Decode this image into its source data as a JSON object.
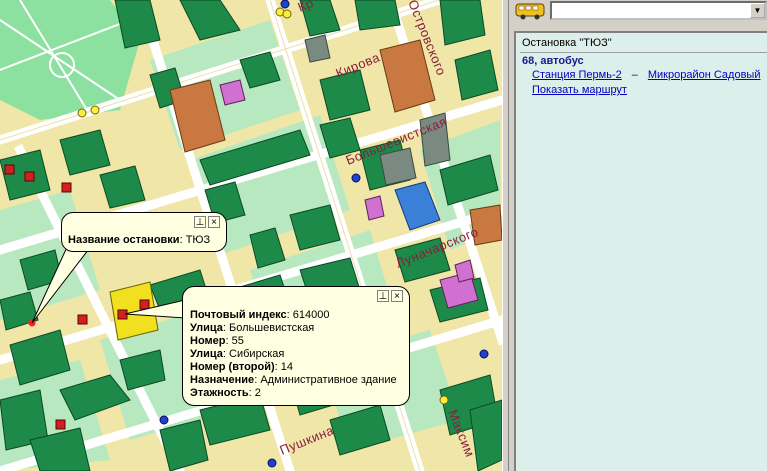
{
  "map": {
    "streets": {
      "kirova": "Кирова",
      "ostrovskogo": "Островского",
      "bolshevistskaya": "Большевистская",
      "lunacharskogo": "Луначарского",
      "pushkina": "Пушкина",
      "maksim": "Максим",
      "krasnoarm": "Кр"
    },
    "colors": {
      "background": "#f0e6a8",
      "grass": "#8ce0a0",
      "building": "#1e8a4a",
      "road": "#ffffff",
      "label": "#8a1e3c"
    }
  },
  "stop_bubble": {
    "label": "Название остановки",
    "value": "ТЮЗ",
    "pin_icon": "pin-icon",
    "close_label": "×"
  },
  "building_bubble": {
    "rows": [
      {
        "label": "Почтовый индекс",
        "value": "614000"
      },
      {
        "label": "Улица",
        "value": "Большевистская"
      },
      {
        "label": "Номер",
        "value": "55"
      },
      {
        "label": "Улица",
        "value": "Сибирская"
      },
      {
        "label": "Номер (второй)",
        "value": "14"
      },
      {
        "label": "Назначение",
        "value": "Административное здание"
      },
      {
        "label": "Этажность",
        "value": "2"
      }
    ],
    "close_label": "×"
  },
  "panel": {
    "combo_value": "",
    "combo_arrow": "▼",
    "stop_title": "Остановка \"ТЮЗ\"",
    "route_name": "68, автобус",
    "from_stop": "Станция Пермь-2",
    "dash": "–",
    "to_stop": "Микрорайон Садовый",
    "show_route": "Показать маршрут"
  }
}
